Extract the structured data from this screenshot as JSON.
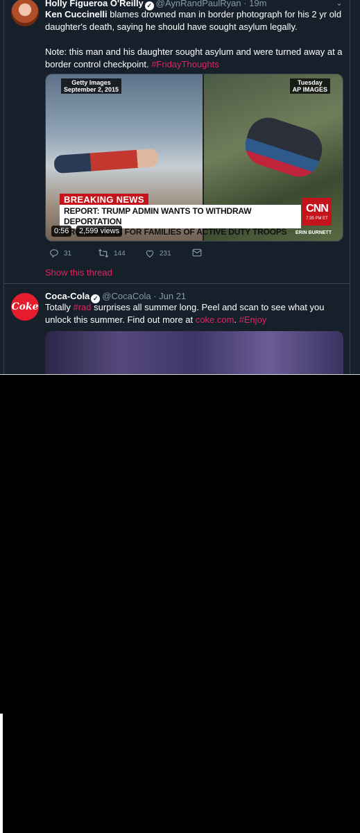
{
  "tweet1": {
    "author_name": "Holly Figueroa O'Reilly",
    "handle_time": "@AynRandPaulRyan · 19m",
    "text_bold": "Ken Cuccinelli",
    "text_line1_rest": " blames drowned man in border photograph for his 2 yr old daughter's death, saying he should have sought asylum legally.",
    "text_para2": "Note: this man and his daughter sought asylum and were turned away at a border control checkpoint. ",
    "hashtag": "#FridayThoughts",
    "media": {
      "credit_left_line1": "Getty Images",
      "credit_left_line2": "September 2, 2015",
      "credit_right_line1": "Tuesday",
      "credit_right_line2": "AP IMAGES",
      "breaking": "BREAKING NEWS",
      "chyron_line1": "REPORT: TRUMP ADMIN WANTS TO WITHDRAW DEPORTATION",
      "chyron_line2": "PROTECTIONS FOR FAMILIES OF ACTIVE DUTY TROOPS",
      "network_logo": "CNN",
      "network_time": "7:35 PM ET",
      "anchor": "ERIN BURNETT",
      "duration": "0:56",
      "views": "2,599 views"
    },
    "actions": {
      "replies": "31",
      "retweets": "144",
      "likes": "231"
    },
    "show_thread": "Show this thread"
  },
  "tweet2": {
    "author_name": "Coca-Cola",
    "handle_time": "@CocaCola · Jun 21",
    "avatar_text": "Coke",
    "text_pre": "Totally ",
    "hashtag1": "#rad",
    "text_mid": " surprises all summer long. Peel and scan to see what you unlock this summer. Find out more at ",
    "link": "coke.com",
    "text_post": ". ",
    "hashtag2": "#Enjoy"
  },
  "colors": {
    "background": "#15202b",
    "accent": "#e0245e",
    "secondary_text": "#8899a6",
    "border": "#38444d"
  },
  "icons": [
    "reply-icon",
    "retweet-icon",
    "like-icon",
    "dm-icon",
    "verified-icon",
    "chevron-down-icon"
  ]
}
